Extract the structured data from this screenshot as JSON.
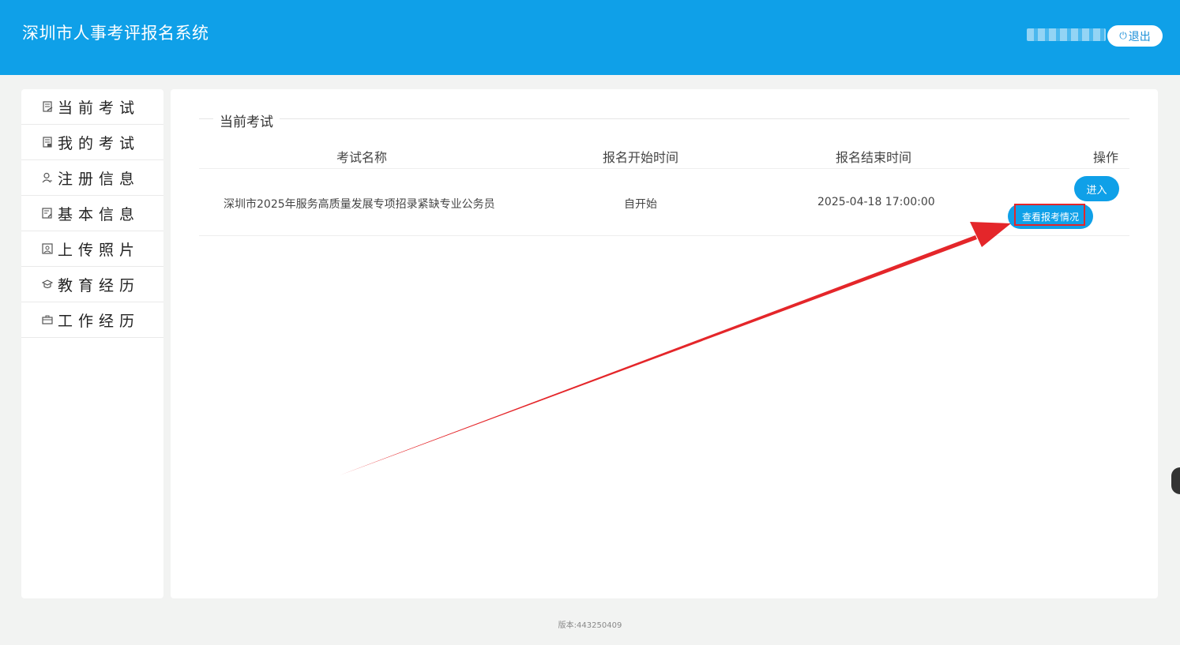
{
  "header": {
    "title": "深圳市人事考评报名系统",
    "logout_label": "退出",
    "logout_icon": "power-icon"
  },
  "sidebar": {
    "items": [
      {
        "label": "当前考试",
        "icon": "exam-list-icon"
      },
      {
        "label": "我的考试",
        "icon": "my-exam-icon"
      },
      {
        "label": "注册信息",
        "icon": "user-icon"
      },
      {
        "label": "基本信息",
        "icon": "id-card-icon"
      },
      {
        "label": "上传照片",
        "icon": "photo-icon"
      },
      {
        "label": "教育经历",
        "icon": "graduation-cap-icon"
      },
      {
        "label": "工作经历",
        "icon": "briefcase-icon"
      }
    ]
  },
  "main": {
    "section_title": "当前考试",
    "table": {
      "headers": [
        "考试名称",
        "报名开始时间",
        "报名结束时间",
        "操作"
      ],
      "rows": [
        {
          "name": "深圳市2025年服务高质量发展专项招录紧缺专业公务员",
          "start": "自开始",
          "end": "2025-04-18 17:00:00",
          "enter_label": "进入",
          "status_label": "查看报考情况"
        }
      ]
    }
  },
  "annotation": {
    "color": "#e4262a"
  },
  "footer": {
    "version": "版本:443250409"
  },
  "colors": {
    "primary": "#0fa0e8"
  }
}
